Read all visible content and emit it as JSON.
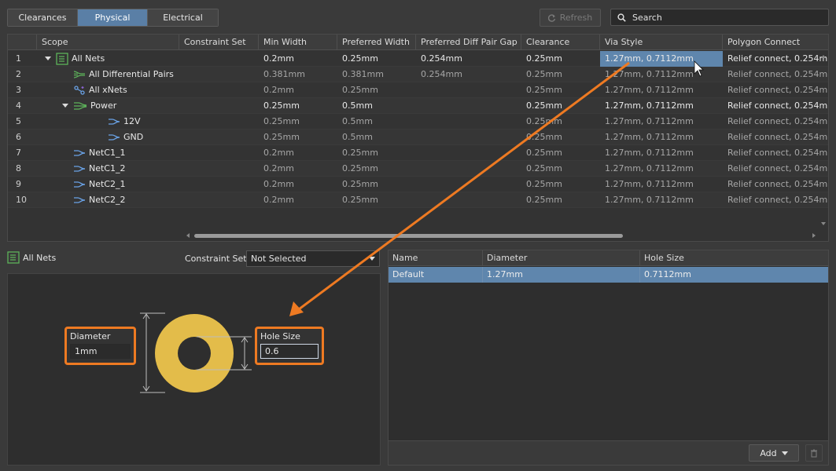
{
  "tabs": [
    {
      "label": "Clearances",
      "active": false
    },
    {
      "label": "Physical",
      "active": true
    },
    {
      "label": "Electrical",
      "active": false
    }
  ],
  "toolbar": {
    "refresh_label": "Refresh",
    "search_placeholder": "Search"
  },
  "grid": {
    "columns": [
      "Scope",
      "Constraint Set",
      "Min Width",
      "Preferred Width",
      "Preferred Diff Pair Gap",
      "Clearance",
      "Via Style",
      "Polygon Connect"
    ],
    "rows": [
      {
        "num": "1",
        "scope": "All Nets",
        "icon": "all-nets-icon",
        "expanded": true,
        "constraint_set": "",
        "min_width": "0.2mm",
        "preferred_width": "0.25mm",
        "diff_pair_gap": "0.254mm",
        "clearance": "0.25mm",
        "via_style": "1.27mm, 0.7112mm",
        "polygon_connect": "Relief connect, 0.254m",
        "bright": true
      },
      {
        "num": "2",
        "scope": "All Differential Pairs",
        "icon": "diff-pairs-icon",
        "constraint_set": "",
        "min_width": "0.381mm",
        "preferred_width": "0.381mm",
        "diff_pair_gap": "0.254mm",
        "clearance": "0.25mm",
        "via_style": "1.27mm, 0.7112mm",
        "polygon_connect": "Relief connect, 0.254m",
        "bright": false
      },
      {
        "num": "3",
        "scope": "All xNets",
        "icon": "xnets-icon",
        "constraint_set": "",
        "min_width": "0.2mm",
        "preferred_width": "0.25mm",
        "diff_pair_gap": "",
        "clearance": "0.25mm",
        "via_style": "1.27mm, 0.7112mm",
        "polygon_connect": "Relief connect, 0.254m",
        "bright": false
      },
      {
        "num": "4",
        "scope": "Power",
        "icon": "net-class-icon",
        "expanded": true,
        "constraint_set": "",
        "min_width": "0.25mm",
        "preferred_width": "0.5mm",
        "diff_pair_gap": "",
        "clearance": "0.25mm",
        "via_style": "1.27mm, 0.7112mm",
        "polygon_connect": "Relief connect, 0.254m",
        "bright": true
      },
      {
        "num": "5",
        "scope": "12V",
        "icon": "net-icon",
        "constraint_set": "",
        "min_width": "0.25mm",
        "preferred_width": "0.5mm",
        "diff_pair_gap": "",
        "clearance": "0.25mm",
        "via_style": "1.27mm, 0.7112mm",
        "polygon_connect": "Relief connect, 0.254m",
        "bright": false
      },
      {
        "num": "6",
        "scope": "GND",
        "icon": "net-icon",
        "constraint_set": "",
        "min_width": "0.25mm",
        "preferred_width": "0.5mm",
        "diff_pair_gap": "",
        "clearance": "0.25mm",
        "via_style": "1.27mm, 0.7112mm",
        "polygon_connect": "Relief connect, 0.254m",
        "bright": false
      },
      {
        "num": "7",
        "scope": "NetC1_1",
        "icon": "net-icon",
        "constraint_set": "",
        "min_width": "0.2mm",
        "preferred_width": "0.25mm",
        "diff_pair_gap": "",
        "clearance": "0.25mm",
        "via_style": "1.27mm, 0.7112mm",
        "polygon_connect": "Relief connect, 0.254m",
        "bright": false
      },
      {
        "num": "8",
        "scope": "NetC1_2",
        "icon": "net-icon",
        "constraint_set": "",
        "min_width": "0.2mm",
        "preferred_width": "0.25mm",
        "diff_pair_gap": "",
        "clearance": "0.25mm",
        "via_style": "1.27mm, 0.7112mm",
        "polygon_connect": "Relief connect, 0.254m",
        "bright": false
      },
      {
        "num": "9",
        "scope": "NetC2_1",
        "icon": "net-icon",
        "constraint_set": "",
        "min_width": "0.2mm",
        "preferred_width": "0.25mm",
        "diff_pair_gap": "",
        "clearance": "0.25mm",
        "via_style": "1.27mm, 0.7112mm",
        "polygon_connect": "Relief connect, 0.254m",
        "bright": false
      },
      {
        "num": "10",
        "scope": "NetC2_2",
        "icon": "net-icon",
        "constraint_set": "",
        "min_width": "0.2mm",
        "preferred_width": "0.25mm",
        "diff_pair_gap": "",
        "clearance": "0.25mm",
        "via_style": "1.27mm, 0.7112mm",
        "polygon_connect": "Relief connect, 0.254m",
        "bright": false
      }
    ]
  },
  "details": {
    "scope": "All Nets",
    "constraint_set_label": "Constraint Set",
    "constraint_set_value": "Not Selected",
    "diameter_label": "Diameter",
    "diameter_value": "1mm",
    "hole_label": "Hole Size",
    "hole_value": "0.6"
  },
  "via_table": {
    "columns": [
      "Name",
      "Diameter",
      "Hole Size"
    ],
    "rows": [
      {
        "name": "Default",
        "diameter": "1.27mm",
        "hole": "0.7112mm"
      }
    ],
    "add_label": "Add"
  },
  "colors": {
    "accent": "#5a7fa6",
    "selection": "#5f86ad",
    "highlight": "#ee7a22",
    "via_copper": "#e3bc4a"
  }
}
